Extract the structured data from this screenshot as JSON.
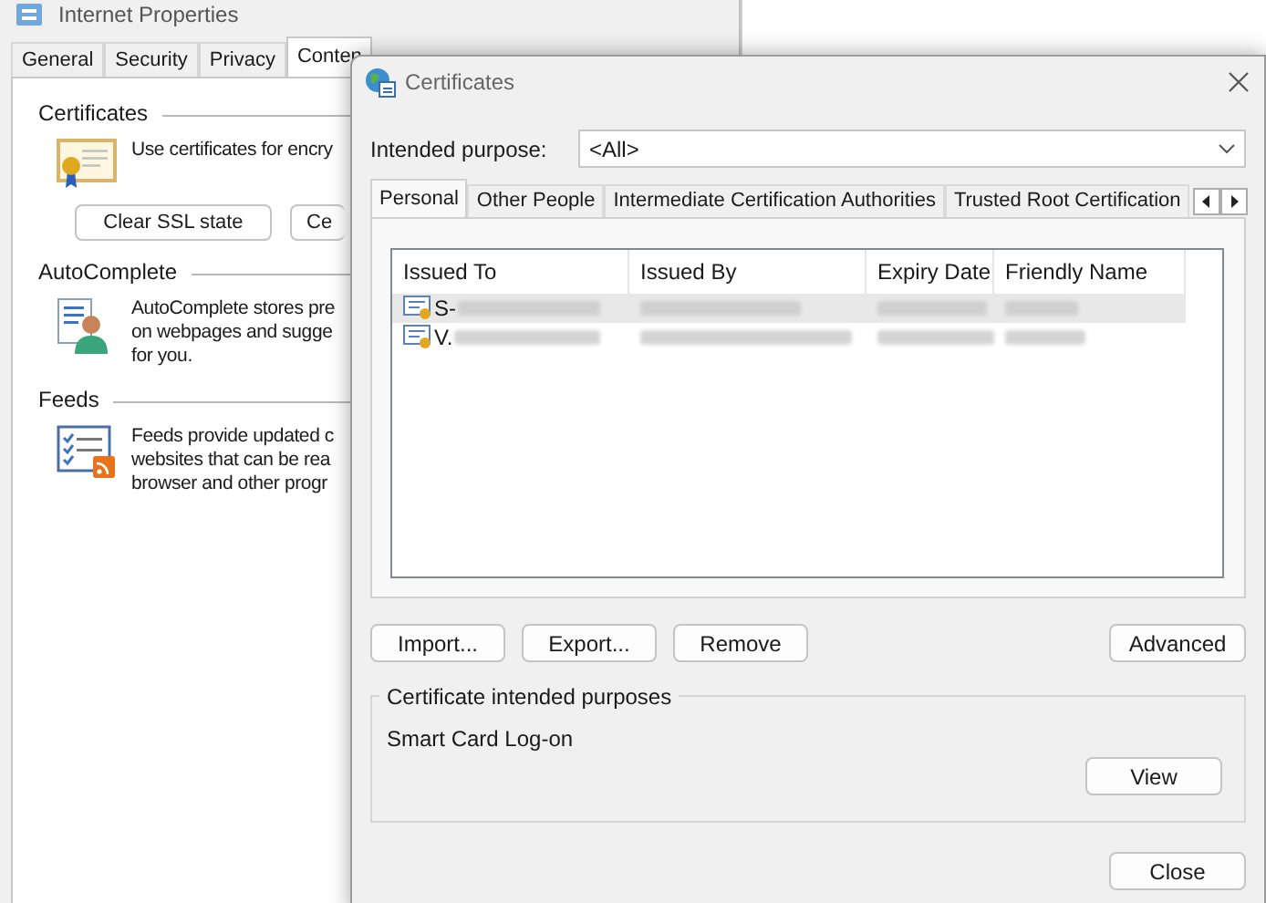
{
  "back_window": {
    "title": "Internet Properties",
    "tabs": [
      {
        "label": "General",
        "selected": false
      },
      {
        "label": "Security",
        "selected": false
      },
      {
        "label": "Privacy",
        "selected": false
      },
      {
        "label": "Conten",
        "selected": true
      }
    ],
    "sections": [
      {
        "kind": "certificates",
        "heading": "Certificates",
        "lines": [
          "Use certificates for encry"
        ],
        "buttons": [
          "Clear SSL state",
          "Ce"
        ]
      },
      {
        "kind": "autocomplete",
        "heading": "AutoComplete",
        "lines": [
          "AutoComplete stores pre",
          "on webpages and sugge",
          "for you."
        ]
      },
      {
        "kind": "feeds",
        "heading": "Feeds",
        "lines": [
          "Feeds provide updated c",
          "websites that can be rea",
          "browser and other progr"
        ]
      }
    ]
  },
  "dialog": {
    "title": "Certificates",
    "intended_purpose": {
      "label": "Intended purpose:",
      "value": "<All>"
    },
    "tabs": [
      {
        "label": "Personal",
        "selected": true
      },
      {
        "label": "Other People",
        "selected": false
      },
      {
        "label": "Intermediate Certification Authorities",
        "selected": false
      },
      {
        "label": "Trusted Root Certification",
        "selected": false
      }
    ],
    "table": {
      "columns": [
        "Issued To",
        "Issued By",
        "Expiry Date",
        "Friendly Name"
      ],
      "rows": [
        {
          "issued_to": "S-",
          "selected": true
        },
        {
          "issued_to": "V.",
          "selected": false
        }
      ]
    },
    "buttons": [
      "Import...",
      "Export...",
      "Remove"
    ],
    "advanced_button": "Advanced",
    "purposes_group": {
      "title": "Certificate intended purposes",
      "text": "Smart Card Log-on",
      "button": "View"
    },
    "close_button": "Close"
  }
}
